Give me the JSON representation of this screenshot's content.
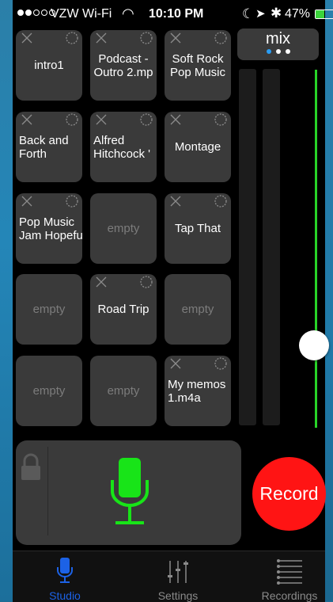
{
  "status_bar": {
    "carrier": "VZW Wi-Fi",
    "wifi_icon": "wifi-icon",
    "time": "10:10 PM",
    "battery": "47%",
    "battery_level": 0.47
  },
  "pads": [
    {
      "label": "intro1",
      "empty": false
    },
    {
      "label": "Podcast -\nOutro 2.mp",
      "empty": false
    },
    {
      "label": "Soft Rock\nPop Music",
      "empty": false
    },
    {
      "label": "Back and\nForth",
      "empty": false
    },
    {
      "label": "Alfred\nHitchcock '",
      "empty": false
    },
    {
      "label": "Montage",
      "empty": false
    },
    {
      "label": "Pop Music\nJam Hopefu",
      "empty": false
    },
    {
      "label": "empty",
      "empty": true
    },
    {
      "label": "Tap That",
      "empty": false
    },
    {
      "label": "empty",
      "empty": true
    },
    {
      "label": "Road Trip",
      "empty": false
    },
    {
      "label": "empty",
      "empty": true
    },
    {
      "label": "empty",
      "empty": true
    },
    {
      "label": "empty",
      "empty": true
    },
    {
      "label": "My memos\n1.m4a",
      "empty": false
    }
  ],
  "mix": {
    "title": "mix",
    "page_indicator": {
      "current": 1,
      "total": 3
    },
    "fader_level": 0.23
  },
  "record": {
    "label": "Record",
    "color": "#ff1414"
  },
  "mic": {
    "color": "#18e418"
  },
  "tabs": [
    {
      "label": "Studio",
      "icon": "studio-mic-icon",
      "active": true
    },
    {
      "label": "Settings",
      "icon": "sliders-icon",
      "active": false
    },
    {
      "label": "Recordings",
      "icon": "list-icon",
      "active": false
    }
  ]
}
